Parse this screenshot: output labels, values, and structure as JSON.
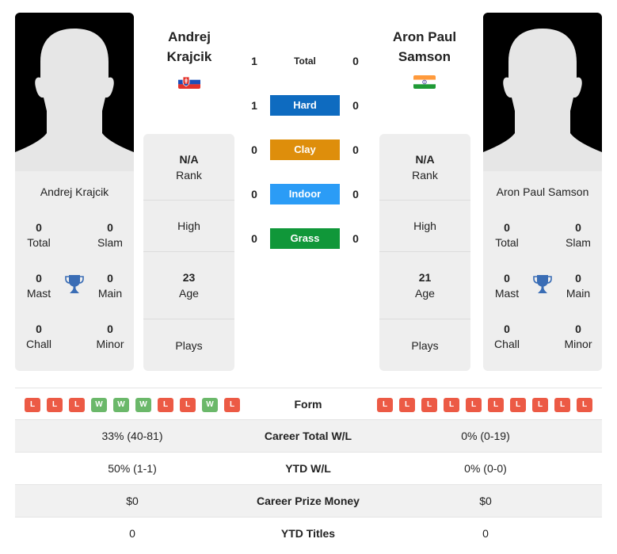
{
  "player_left": {
    "name": "Andrej Krajcik",
    "name_line1": "Andrej",
    "name_line2": "Krajcik",
    "country": "Slovakia",
    "flag_icon": "flag-slovakia",
    "titles": {
      "total": {
        "value": "0",
        "label": "Total"
      },
      "slam": {
        "value": "0",
        "label": "Slam"
      },
      "mast": {
        "value": "0",
        "label": "Mast"
      },
      "main": {
        "value": "0",
        "label": "Main"
      },
      "chall": {
        "value": "0",
        "label": "Chall"
      },
      "minor": {
        "value": "0",
        "label": "Minor"
      }
    },
    "info": {
      "rank_value": "N/A",
      "rank_label": "Rank",
      "high_label": "High",
      "age_value": "23",
      "age_label": "Age",
      "plays_label": "Plays"
    },
    "form": [
      "L",
      "L",
      "L",
      "W",
      "W",
      "W",
      "L",
      "L",
      "W",
      "L"
    ]
  },
  "player_right": {
    "name": "Aron Paul Samson",
    "name_line1": "Aron Paul",
    "name_line2": "Samson",
    "country": "India",
    "flag_icon": "flag-india",
    "titles": {
      "total": {
        "value": "0",
        "label": "Total"
      },
      "slam": {
        "value": "0",
        "label": "Slam"
      },
      "mast": {
        "value": "0",
        "label": "Mast"
      },
      "main": {
        "value": "0",
        "label": "Main"
      },
      "chall": {
        "value": "0",
        "label": "Chall"
      },
      "minor": {
        "value": "0",
        "label": "Minor"
      }
    },
    "info": {
      "rank_value": "N/A",
      "rank_label": "Rank",
      "high_label": "High",
      "age_value": "21",
      "age_label": "Age",
      "plays_label": "Plays"
    },
    "form": [
      "L",
      "L",
      "L",
      "L",
      "L",
      "L",
      "L",
      "L",
      "L",
      "L"
    ]
  },
  "head_to_head": [
    {
      "label": "Total",
      "left": "1",
      "right": "0",
      "color": ""
    },
    {
      "label": "Hard",
      "left": "1",
      "right": "0",
      "color": "#0e6bc0"
    },
    {
      "label": "Clay",
      "left": "0",
      "right": "0",
      "color": "#de8e0b"
    },
    {
      "label": "Indoor",
      "left": "0",
      "right": "0",
      "color": "#2b9cf6"
    },
    {
      "label": "Grass",
      "left": "0",
      "right": "0",
      "color": "#109739"
    }
  ],
  "form_label": "Form",
  "stats": [
    {
      "label": "Career Total W/L",
      "left": "33% (40-81)",
      "right": "0% (0-19)"
    },
    {
      "label": "YTD W/L",
      "left": "50% (1-1)",
      "right": "0% (0-0)"
    },
    {
      "label": "Career Prize Money",
      "left": "$0",
      "right": "$0"
    },
    {
      "label": "YTD Titles",
      "left": "0",
      "right": "0"
    }
  ],
  "colors": {
    "loss": "#ec5a45",
    "win": "#6bb86a",
    "trophy": "#3a6db5",
    "card_bg": "#eeeeee"
  }
}
